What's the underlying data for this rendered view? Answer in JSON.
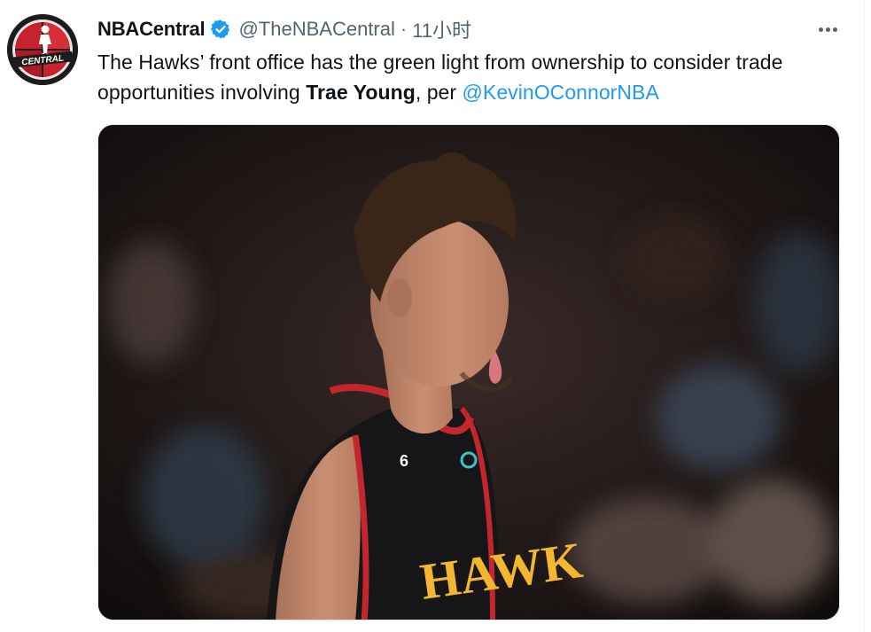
{
  "tweet": {
    "author": {
      "display_name": "NBACentral",
      "handle": "@TheNBACentral",
      "verified": true,
      "avatar_logo_text": "CENTRAL"
    },
    "separator": "·",
    "timestamp": "11小时",
    "text": {
      "part1": "The Hawks’ front office has the green light from ownership to consider trade opportunities involving ",
      "bold": "Trae Young",
      "part2": ", per ",
      "mention": "@KevinOConnorNBA"
    },
    "media": {
      "jersey_number": "6",
      "jersey_text": "HAWK"
    },
    "more_icon": "more-horizontal-icon",
    "colors": {
      "accent": "#1d9bf0",
      "secondary_text": "#536471",
      "text": "#0f1419"
    }
  }
}
